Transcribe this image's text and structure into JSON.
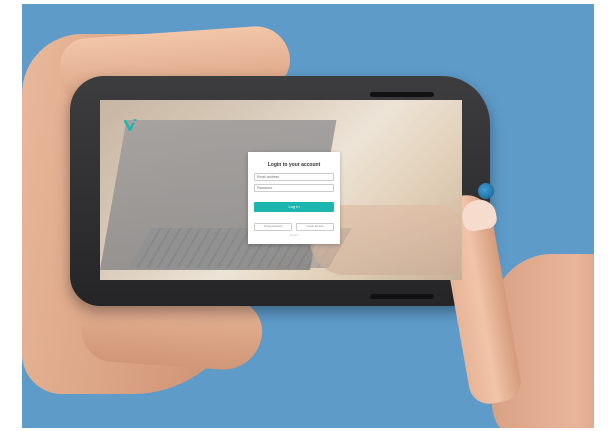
{
  "login": {
    "title": "Login to your account",
    "email_placeholder": "Email address",
    "password_placeholder": "Password",
    "login_button": "Log In",
    "forgot_password_link": "Forgot password",
    "create_account_link": "Create account",
    "footer_text": "Privacy"
  },
  "colors": {
    "background": "#5e9bc9",
    "accent": "#1db5b0",
    "phone_body": "#2e2e30",
    "home_button": "#2b7fb8"
  },
  "icons": {
    "app_logo": "v-check-logo-icon"
  }
}
